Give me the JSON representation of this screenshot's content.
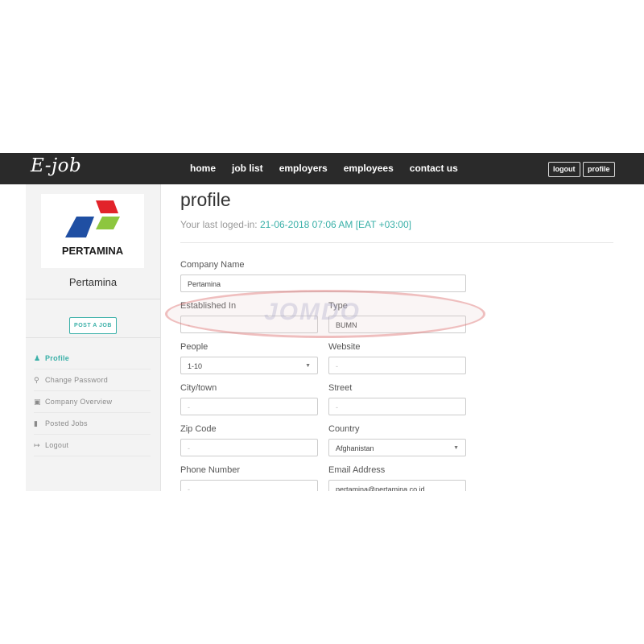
{
  "nav": {
    "brand": "E-job",
    "links": [
      "home",
      "job list",
      "employers",
      "employees",
      "contact us"
    ],
    "logout_label": "logout",
    "profile_label": "profile"
  },
  "sidebar": {
    "logo_text": "PERTAMINA",
    "company_name": "Pertamina",
    "post_job_label": "POST A JOB",
    "menu": [
      {
        "label": "Profile",
        "icon": "user-icon",
        "active": true
      },
      {
        "label": "Change Password",
        "icon": "key-icon",
        "active": false
      },
      {
        "label": "Company Overview",
        "icon": "briefcase-icon",
        "active": false
      },
      {
        "label": "Posted Jobs",
        "icon": "bookmark-icon",
        "active": false
      },
      {
        "label": "Logout",
        "icon": "sign-out-icon",
        "active": false
      }
    ]
  },
  "main": {
    "title": "profile",
    "last_login_prefix": "Your last loged-in:",
    "last_login_value": "21-06-2018 07:06 AM [EAT +03:00]"
  },
  "form": {
    "company_name": {
      "label": "Company Name",
      "value": "Pertamina"
    },
    "established_in": {
      "label": "Established In",
      "value": "-"
    },
    "type": {
      "label": "Type",
      "value": "BUMN"
    },
    "people": {
      "label": "People",
      "value": "1-10"
    },
    "website": {
      "label": "Website",
      "value": "-"
    },
    "city": {
      "label": "City/town",
      "value": "-"
    },
    "street": {
      "label": "Street",
      "value": "-"
    },
    "zip": {
      "label": "Zip Code",
      "value": "-"
    },
    "country": {
      "label": "Country",
      "value": "Afghanistan"
    },
    "phone": {
      "label": "Phone Number",
      "value": "-"
    },
    "email": {
      "label": "Email Address",
      "value": "pertamina@pertamina.co.id"
    }
  },
  "colors": {
    "accent": "#3ab0a8",
    "navbar": "#2a2a2a",
    "logo_red": "#e2232a",
    "logo_blue": "#1f4fa3",
    "logo_green": "#8dc63f"
  },
  "watermark": "JOMDO"
}
